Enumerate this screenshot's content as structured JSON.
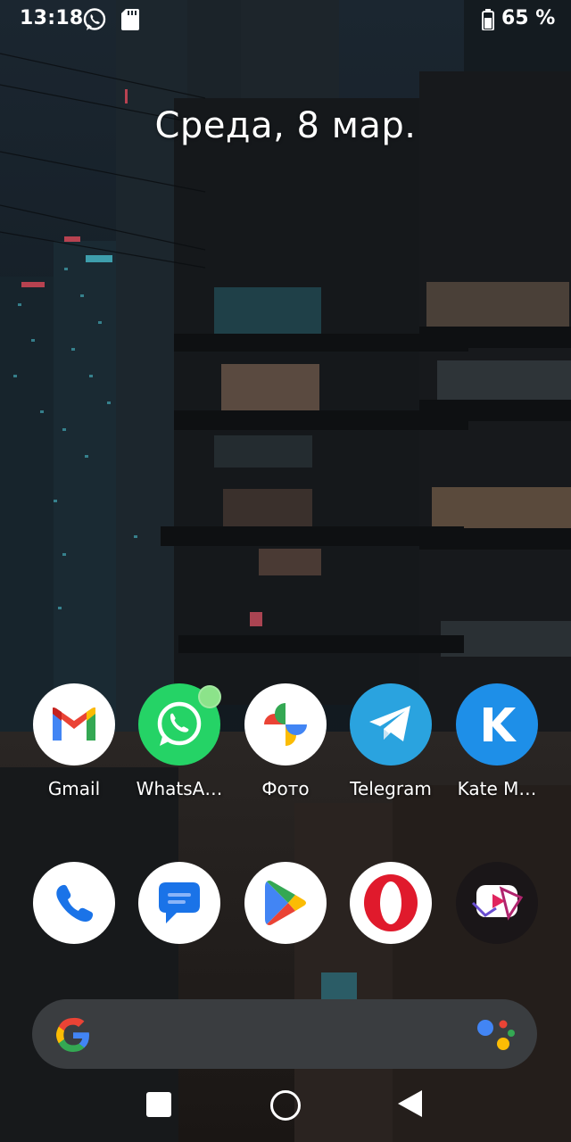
{
  "status_bar": {
    "time": "13:18",
    "battery_percent": "65 %",
    "notification_icons": [
      "whatsapp-icon",
      "sd-card-icon"
    ],
    "battery_icon": "battery-icon"
  },
  "date_widget": {
    "text": "Среда, 8 мар."
  },
  "apps_row1": [
    {
      "label": "Gmail",
      "icon": "gmail-icon"
    },
    {
      "label": "WhatsA…",
      "icon": "whatsapp-icon",
      "notification_dot": true
    },
    {
      "label": "Фото",
      "icon": "google-photos-icon"
    },
    {
      "label": "Telegram",
      "icon": "telegram-icon"
    },
    {
      "label": "Kate M…",
      "icon": "kate-mobile-icon"
    }
  ],
  "dock": [
    {
      "icon": "phone-icon"
    },
    {
      "icon": "messages-icon"
    },
    {
      "icon": "play-store-icon"
    },
    {
      "icon": "opera-icon"
    },
    {
      "icon": "video-player-icon"
    }
  ],
  "search_bar": {
    "left_icon": "google-g-icon",
    "right_icon": "google-assistant-icon"
  },
  "nav_bar": {
    "buttons": [
      "recents-button",
      "home-button",
      "back-button"
    ]
  },
  "colors": {
    "whatsapp_green": "#25d366",
    "telegram_blue": "#2aa3df",
    "kate_blue": "#1e8fe8",
    "opera_red": "#e01a2c",
    "searchbar_bg": "#3a3d40"
  }
}
